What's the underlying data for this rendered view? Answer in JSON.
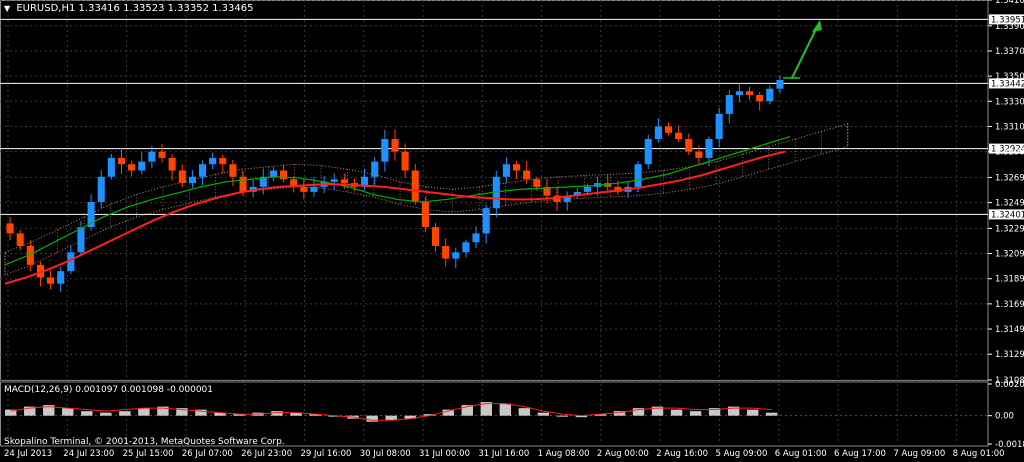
{
  "header": {
    "symbol": "EURUSD,H1",
    "ohlc": "1.33416 1.33523 1.33352 1.33465"
  },
  "macd": {
    "label": "MACD(12,26,9) 0.001097 0.001098 -0.000001"
  },
  "footer": {
    "copyright": "Skopalino Terminal, © 2001-2013, MetaQuotes Software Corp."
  },
  "colors": {
    "background": "#000000",
    "grid": "#3a3a3a",
    "bull_candle": "#1e90ff",
    "bear_candle": "#ff4500",
    "ma_slow": "#ff2020",
    "ma_fast": "#00b000",
    "cloud": "#e8b090",
    "arrow": "#20c020",
    "hline": "#ffffff"
  },
  "chart_data": [
    {
      "type": "line",
      "title": "EURUSD,H1",
      "y_ticks": [
        "1.34105",
        "1.33900",
        "1.33700",
        "1.33500",
        "1.33300",
        "1.33100",
        "1.32900",
        "1.32695",
        "1.32495",
        "1.32290",
        "1.32090",
        "1.31890",
        "1.31690",
        "1.31490",
        "1.31290",
        "1.31085"
      ],
      "price_tags": [
        "1.33951",
        "1.33442",
        "1.32924",
        "1.32401"
      ],
      "horizontal_levels": [
        1.33951,
        1.33442,
        1.32924,
        1.32401
      ],
      "x_tick_labels": [
        "24 Jul 2013",
        "24 Jul 23:00",
        "25 Jul 15:00",
        "26 Jul 07:00",
        "26 Jul 23:00",
        "29 Jul 16:00",
        "30 Jul 08:00",
        "31 Jul 00:00",
        "31 Jul 16:00",
        "1 Aug 08:00",
        "2 Aug 00:00",
        "2 Aug 16:00",
        "5 Aug 09:00",
        "6 Aug 01:00",
        "6 Aug 17:00",
        "7 Aug 09:00",
        "8 Aug 01:00"
      ],
      "ylim": [
        1.31085,
        1.34105
      ],
      "close_series": [
        1.3225,
        1.3215,
        1.32,
        1.319,
        1.3185,
        1.3195,
        1.321,
        1.323,
        1.325,
        1.327,
        1.3285,
        1.328,
        1.3275,
        1.3282,
        1.329,
        1.3285,
        1.3275,
        1.3265,
        1.327,
        1.328,
        1.3285,
        1.328,
        1.327,
        1.3258,
        1.3262,
        1.327,
        1.3275,
        1.3268,
        1.3262,
        1.3258,
        1.3262,
        1.3266,
        1.3268,
        1.3265,
        1.3262,
        1.327,
        1.3282,
        1.33,
        1.329,
        1.3275,
        1.325,
        1.323,
        1.3215,
        1.3205,
        1.321,
        1.3218,
        1.3225,
        1.3245,
        1.327,
        1.328,
        1.3275,
        1.3268,
        1.3262,
        1.3255,
        1.325,
        1.3255,
        1.3258,
        1.3262,
        1.3265,
        1.3262,
        1.3258,
        1.3262,
        1.328,
        1.33,
        1.331,
        1.3305,
        1.33,
        1.329,
        1.3285,
        1.33,
        1.332,
        1.3335,
        1.3338,
        1.3335,
        1.333,
        1.334,
        1.3347
      ],
      "ma_slow": [
        1.3185,
        1.319,
        1.3196,
        1.3203,
        1.3211,
        1.3219,
        1.3227,
        1.3235,
        1.3242,
        1.3248,
        1.3253,
        1.3257,
        1.326,
        1.3262,
        1.3263,
        1.3264,
        1.3264,
        1.3263,
        1.3262,
        1.326,
        1.3258,
        1.3256,
        1.3254,
        1.3253,
        1.3252,
        1.3252,
        1.3253,
        1.3255,
        1.3257,
        1.3259,
        1.3261,
        1.3264,
        1.3267,
        1.3271,
        1.3276,
        1.3281,
        1.3286,
        1.329
      ],
      "ma_fast": [
        1.32,
        1.3208,
        1.3218,
        1.3228,
        1.3238,
        1.3246,
        1.3252,
        1.3257,
        1.3262,
        1.3266,
        1.3268,
        1.327,
        1.3269,
        1.3266,
        1.3262,
        1.3256,
        1.3252,
        1.325,
        1.3252,
        1.3255,
        1.3258,
        1.326,
        1.3261,
        1.3262,
        1.3263,
        1.3265,
        1.3268,
        1.3272,
        1.3278,
        1.3284,
        1.329,
        1.3296,
        1.3302
      ]
    },
    {
      "type": "bar",
      "title": "MACD(12,26,9) 0.001097 0.001098 -0.000001",
      "y_ticks": [
        "0.002099",
        "0.00",
        "-0.001877"
      ],
      "ylim": [
        -0.001877,
        0.002099
      ],
      "histogram": [
        0.0004,
        0.0006,
        0.0007,
        0.0005,
        0.0003,
        0.0002,
        0.0003,
        0.0005,
        0.0006,
        0.0005,
        0.0004,
        0.0002,
        0.0001,
        0.0002,
        0.0003,
        0.0002,
        0.0001,
        0.0,
        -0.0002,
        -0.0004,
        -0.0003,
        -0.0002,
        0.0001,
        0.0004,
        0.0007,
        0.0009,
        0.0008,
        0.0005,
        0.0002,
        0.0,
        -0.0001,
        0.0001,
        0.0003,
        0.0005,
        0.0006,
        0.0004,
        0.0003,
        0.0005,
        0.0006,
        0.0004,
        0.0002
      ],
      "signal": [
        0.0003,
        0.0005,
        0.0006,
        0.0005,
        0.0004,
        0.0003,
        0.0004,
        0.0005,
        0.0005,
        0.0004,
        0.0003,
        0.0002,
        0.0001,
        0.0001,
        0.0002,
        0.0002,
        0.0001,
        0.0,
        -0.0001,
        -0.0003,
        -0.0003,
        -0.0002,
        0.0,
        0.0003,
        0.0006,
        0.0008,
        0.0008,
        0.0006,
        0.0003,
        0.0001,
        0.0,
        0.0001,
        0.0002,
        0.0004,
        0.0005,
        0.0005,
        0.0004,
        0.0004,
        0.0005,
        0.0005,
        0.0004
      ]
    }
  ]
}
